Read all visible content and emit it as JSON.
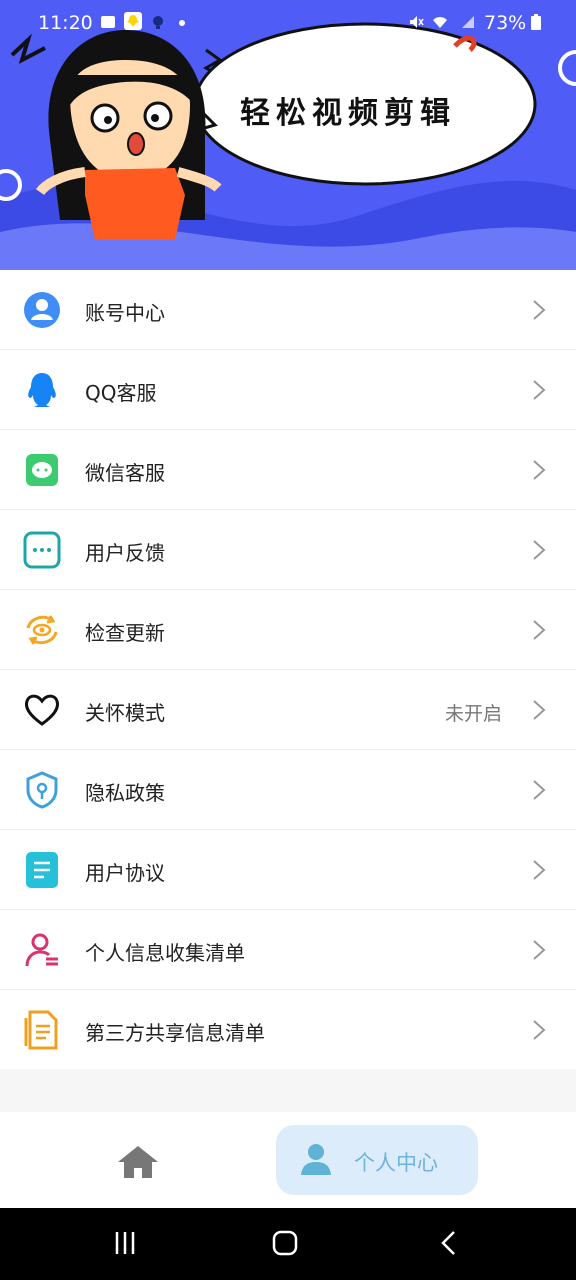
{
  "status_bar": {
    "time": "11:20",
    "battery": "73%"
  },
  "header": {
    "title": "轻松视频剪辑"
  },
  "menu": [
    {
      "label": "账号中心",
      "icon": "account-icon"
    },
    {
      "label": "QQ客服",
      "icon": "qq-icon"
    },
    {
      "label": "微信客服",
      "icon": "wechat-icon"
    },
    {
      "label": "用户反馈",
      "icon": "feedback-icon"
    },
    {
      "label": "检查更新",
      "icon": "update-icon"
    },
    {
      "label": "关怀模式",
      "icon": "heart-icon",
      "value": "未开启"
    },
    {
      "label": "隐私政策",
      "icon": "privacy-shield-icon"
    },
    {
      "label": "用户协议",
      "icon": "agreement-doc-icon"
    },
    {
      "label": "个人信息收集清单",
      "icon": "personal-info-icon"
    },
    {
      "label": "第三方共享信息清单",
      "icon": "third-party-doc-icon"
    }
  ],
  "tabbar": {
    "home_icon": "home-icon",
    "me_label": "个人中心"
  },
  "colors": {
    "header_blue": "#4f5cf5",
    "tab_active_bg": "#dcecfb",
    "tab_active_text": "#6fb4d8"
  }
}
